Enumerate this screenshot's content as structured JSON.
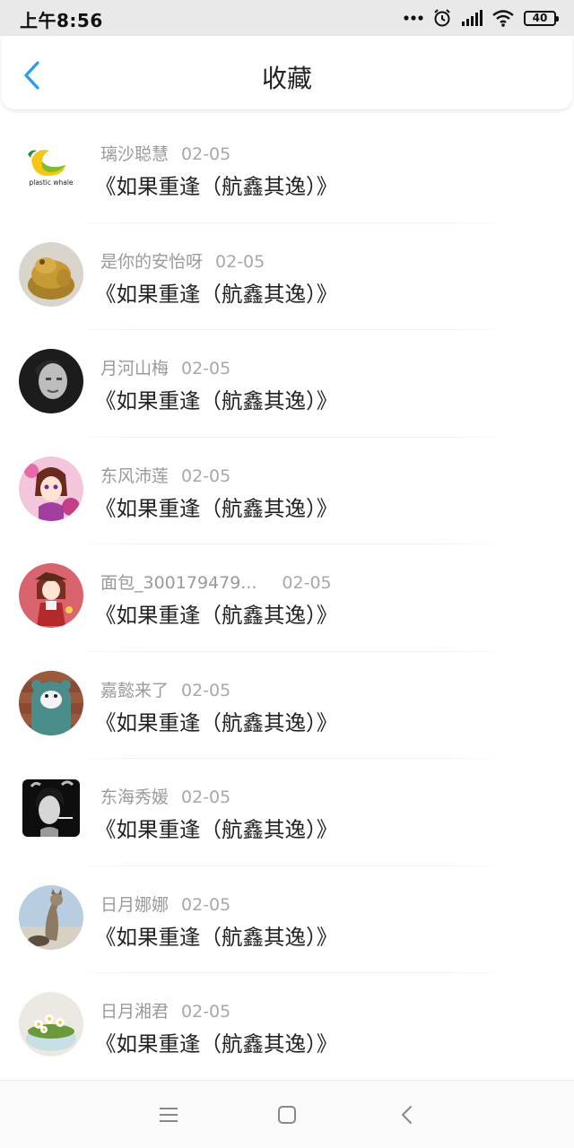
{
  "status_bar": {
    "time": "上午8:56",
    "battery": "40",
    "icons": [
      "more-dots-icon",
      "alarm-icon",
      "signal-icon",
      "wifi-icon",
      "battery-icon"
    ]
  },
  "header": {
    "title": "收藏",
    "back_icon": "chevron-left-icon"
  },
  "items": [
    {
      "user": "璃沙聪慧",
      "date": "02-05",
      "title": "《如果重逢（航鑫其逸）》",
      "avatar": "plastic-whale-logo"
    },
    {
      "user": "是你的安怡呀",
      "date": "02-05",
      "title": "《如果重逢（航鑫其逸）》",
      "avatar": "golden-toad-statue"
    },
    {
      "user": "月河山梅",
      "date": "02-05",
      "title": "《如果重逢（航鑫其逸）》",
      "avatar": "bw-portrait"
    },
    {
      "user": "东风沛莲",
      "date": "02-05",
      "title": "《如果重逢（航鑫其逸）》",
      "avatar": "anime-girl-pink"
    },
    {
      "user": "面包_300179479...",
      "date": "02-05",
      "title": "《如果重逢（航鑫其逸）》",
      "avatar": "anime-girl-red"
    },
    {
      "user": "嘉懿来了",
      "date": "02-05",
      "title": "《如果重逢（航鑫其逸）》",
      "avatar": "bear-hoodie"
    },
    {
      "user": "东海秀媛",
      "date": "02-05",
      "title": "《如果重逢（航鑫其逸）》",
      "avatar": "bw-smoker"
    },
    {
      "user": "日月娜娜",
      "date": "02-05",
      "title": "《如果重逢（航鑫其逸）》",
      "avatar": "cat-photo"
    },
    {
      "user": "日月湘君",
      "date": "02-05",
      "title": "《如果重逢（航鑫其逸）》",
      "avatar": "flower-bowl"
    }
  ],
  "logo_text": "plastic whale",
  "nav_bar": {
    "icons": [
      "menu-icon",
      "home-square-icon",
      "back-triangle-icon"
    ]
  },
  "colors": {
    "accent": "#2b9cf0",
    "status_bar_bg": "#e9e9e9",
    "meta_text": "#9a9a9a",
    "title_text": "#222222"
  }
}
